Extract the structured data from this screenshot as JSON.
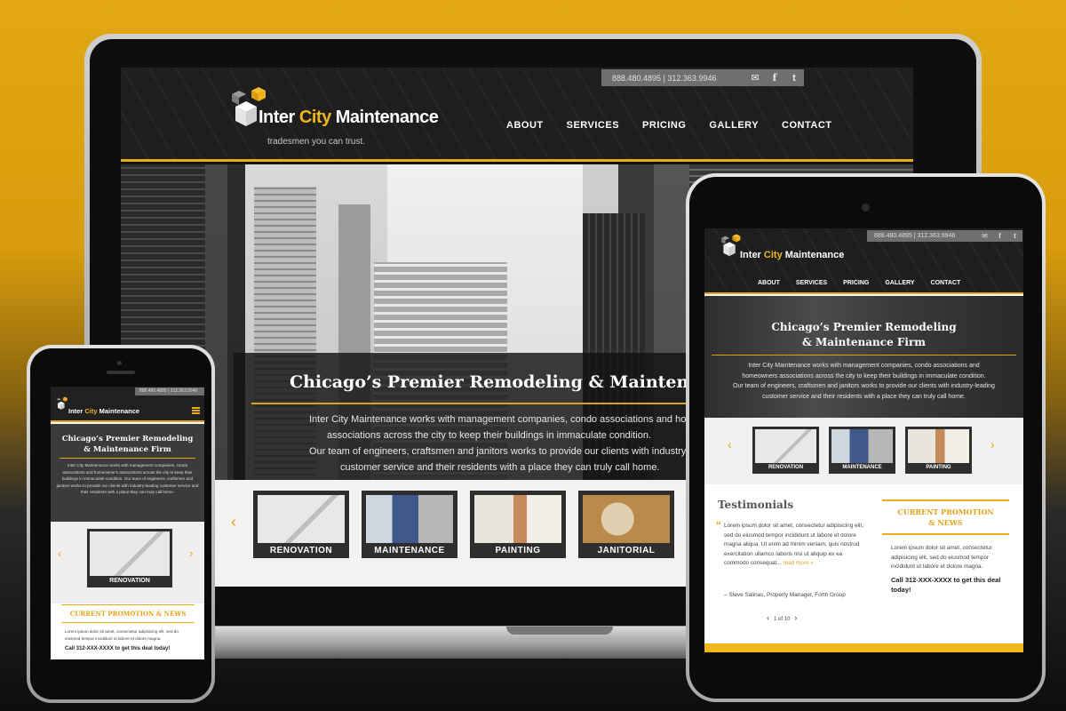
{
  "brand": {
    "name_part1": "Inter",
    "name_accent": "City",
    "name_part2": "Maintenance",
    "tagline": "tradesmen you can trust.",
    "accent_color": "#e8ac16"
  },
  "contact": {
    "phones": "888.480.4895  |  312.363.9946",
    "icons": [
      "mail-icon",
      "facebook-icon",
      "twitter-icon"
    ]
  },
  "nav": [
    "ABOUT",
    "SERVICES",
    "PRICING",
    "GALLERY",
    "CONTACT"
  ],
  "laptop": {
    "hero_title": "Chicago’s Premier Remodeling & Maintenance",
    "hero_lines": [
      "Inter City Maintenance works with management companies, condo associations and home",
      "associations across the city to keep their buildings in immaculate condition.",
      "Our team of engineers, craftsmen and janitors works to provide our clients with industry-",
      "customer service and their residents with a place they can truly call home."
    ],
    "services": [
      "RENOVATION",
      "MAINTENANCE",
      "PAINTING",
      "JANITORIAL"
    ]
  },
  "tablet": {
    "hero_title_1": "Chicago’s Premier Remodeling",
    "hero_title_2": "& Maintenance Firm",
    "hero_lines": [
      "Inter City Maintenance works with management companies, condo associations and",
      "homeowners associations across the city to keep their buildings in immaculate condition.",
      "Our team of engineers, craftsmen and janitors works to provide our clients with industry-leading",
      "customer service and their residents with a place they can truly call home."
    ],
    "services": [
      "RENOVATION",
      "MAINTENANCE",
      "PAINTING"
    ],
    "testimonials": {
      "title": "Testimonials",
      "body": "Lorem ipsum dolor sit amet, consectetur adipisicing elit, sed do eiusmod tempor incididunt ut labore et dolore magna aliqua. Ut enim ad minim veniam, quis nostrud exercitation ullamco laboris nisi ut aliquip ex ea commodo consequat...",
      "read_more": "read more »",
      "author": "– Steve Salinas, Property Manager, Forth Group",
      "pager": "1 of 10"
    },
    "promo": {
      "title_1": "CURRENT PROMOTION",
      "title_2": "& NEWS",
      "body": "Lorem ipsum dolor sit amet, consectetur adipisicing elit, sed do eiusmod tempor incididunt ut labore et dolore magna.",
      "call": "Call 312-XXX-XXXX to get this deal today!"
    }
  },
  "phone": {
    "phones": "888.480.4895  |  312.363.9946",
    "hero_title_1": "Chicago’s Premier Remodeling",
    "hero_title_2": "& Maintenance Firm",
    "hero_body": "Inter City Maintenance works with management companies, condo associations and homeowner's associations across the city to keep their buildings in immaculate condition. Our team of engineers, craftsmen and janitors works to provide our clients with industry-leading customer service and their residents with a place they can truly call home.",
    "service": "RENOVATION",
    "promo_title": "CURRENT PROMOTION & NEWS",
    "promo_body": "Lorem ipsum dolor sit amet, consectetur adipisicing elit, sed do eiusmod tempor incididunt ut labore et dolore magna.",
    "call": "Call 312-XXX-XXXX to get this deal today!"
  }
}
